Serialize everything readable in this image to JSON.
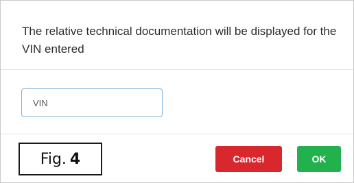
{
  "dialog": {
    "message": "The relative technical documentation will be displayed for the VIN entered",
    "vin_field": {
      "placeholder": "VIN",
      "value": ""
    },
    "cancel_label": "Cancel",
    "ok_label": "OK"
  },
  "figure": {
    "prefix": "Fig.",
    "number": "4"
  },
  "colors": {
    "cancel": "#d9272e",
    "ok": "#22b14c",
    "input_border": "#7fb3dc"
  }
}
